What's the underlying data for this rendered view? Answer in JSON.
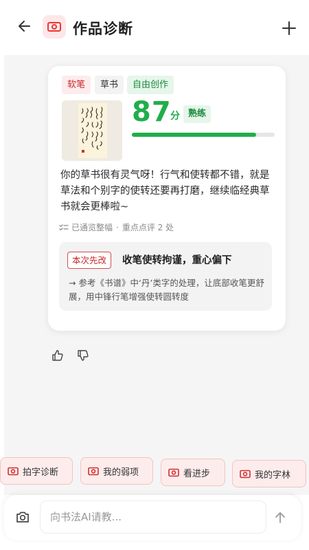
{
  "header": {
    "title": "作品诊断",
    "back_icon": "arrow-left-icon",
    "add_icon": "plus-icon",
    "brand_color": "#e53935"
  },
  "diagnosis": {
    "tags": [
      "软笔",
      "草书",
      "自由创作"
    ],
    "score": "87",
    "score_unit": "分",
    "level": "熟练",
    "progress": 0.87,
    "comment": "你的草书很有灵气呀！行气和使转都不错，就是草法和个别字的使转还要再打磨，继续临经典草书就会更棒啦~",
    "meta_status": "已通览整幅",
    "meta_points": "重点点评 2 处",
    "focus": {
      "badge": "本次先改",
      "title": "收笔使转拘谨，重心偏下",
      "detail": "→ 参考《书谱》中‘丹’类字的处理，让底部收笔更舒展，用中锋行笔增强使转圆转度"
    }
  },
  "feedback": {
    "like_icon": "thumbs-up-icon",
    "dislike_icon": "thumbs-down-icon"
  },
  "quick_actions": [
    "拍字诊断",
    "我的弱项",
    "看进步",
    "我的字林"
  ],
  "input": {
    "placeholder": "向书法AI请教...",
    "camera_icon": "camera-icon",
    "send_icon": "arrow-up-icon"
  },
  "colors": {
    "green": "#1fae4a",
    "red": "#c62828",
    "pink_bg": "#fdecec"
  }
}
